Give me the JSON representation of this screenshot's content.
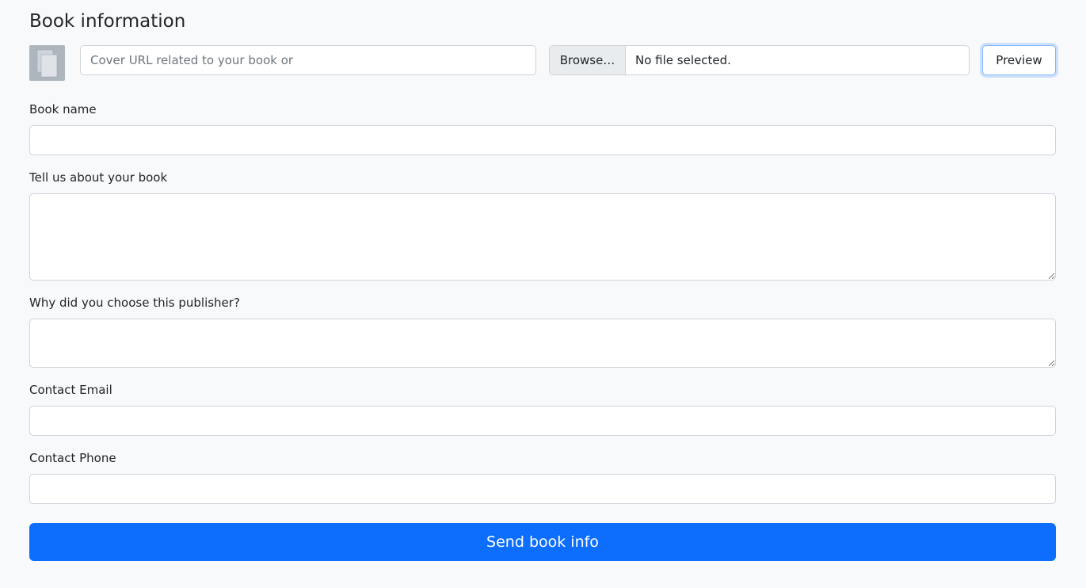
{
  "header": {
    "title": "Book information"
  },
  "cover": {
    "thumbnail_icon": "files-icon",
    "url_placeholder": "Cover URL related to your book or",
    "browse_label": "Browse…",
    "file_status": "No file selected.",
    "preview_label": "Preview"
  },
  "form": {
    "book_name_label": "Book name",
    "book_name_value": "",
    "about_label": "Tell us about your book",
    "about_value": "",
    "publisher_label": "Why did you choose this publisher?",
    "publisher_value": "",
    "email_label": "Contact Email",
    "email_value": "",
    "phone_label": "Contact Phone",
    "phone_value": "",
    "submit_label": "Send book info"
  },
  "colors": {
    "primary": "#0d6efd",
    "background": "#f8f9fa",
    "thumbnail": "#adb5bd"
  }
}
